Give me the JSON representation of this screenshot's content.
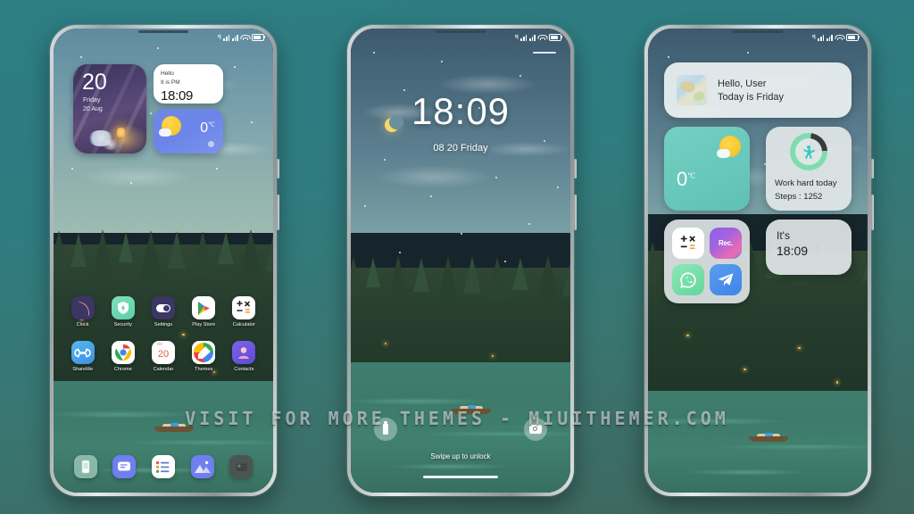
{
  "watermark": "VISIT FOR MORE THEMES - MIUITHEMER.COM",
  "colors": {
    "background_top": "#2d7d83",
    "background_bottom": "#3e655d",
    "accent_teal": "#68c8bb",
    "accent_blue": "#6f86e6",
    "ring_green": "#7fdcb0",
    "widget_grey": "#e2e7e8"
  },
  "status_bar": {
    "icons": [
      "nfc-icon",
      "signal-bars-icon",
      "signal-bars-icon",
      "wifi-icon",
      "battery-icon"
    ]
  },
  "phone1": {
    "label": "home-screen",
    "calendar_widget": {
      "day": "20",
      "weekday": "Friday",
      "date": "20 Aug"
    },
    "hello_widget": {
      "greeting": "Hello",
      "subtitle": "It is PM",
      "time": "18:09"
    },
    "weather_widget": {
      "temperature": "0",
      "unit": "℃",
      "icon": "sun-cloud-icon"
    },
    "apps_row1": [
      {
        "label": "Clock",
        "icon": "clock-icon"
      },
      {
        "label": "Security",
        "icon": "shield-icon"
      },
      {
        "label": "Settings",
        "icon": "toggle-icon"
      },
      {
        "label": "Play Store",
        "icon": "play-store-icon"
      },
      {
        "label": "Calculator",
        "icon": "calculator-icon"
      }
    ],
    "apps_row2": [
      {
        "label": "ShareMe",
        "icon": "shareme-icon"
      },
      {
        "label": "Chrome",
        "icon": "chrome-icon"
      },
      {
        "label": "Calendar",
        "icon": "calendar-icon"
      },
      {
        "label": "Themes",
        "icon": "themes-icon"
      },
      {
        "label": "Contacts",
        "icon": "contacts-icon"
      }
    ],
    "dock": [
      {
        "label": "Phone",
        "icon": "phone-icon"
      },
      {
        "label": "Messages",
        "icon": "messages-icon"
      },
      {
        "label": "Notes",
        "icon": "notes-icon"
      },
      {
        "label": "Gallery",
        "icon": "gallery-icon"
      },
      {
        "label": "Camera",
        "icon": "camera-icon"
      }
    ]
  },
  "phone2": {
    "label": "lock-screen",
    "time": "18:09",
    "date": "08 20 Friday",
    "hint": "Swipe up to unlock",
    "left_button": "flashlight-icon",
    "right_button": "camera-icon"
  },
  "phone3": {
    "label": "home-screen-widgets",
    "hello_widget": {
      "line1": "Hello, User",
      "line2": "Today is Friday",
      "thumb": "map-thumbnail"
    },
    "weather_widget": {
      "temperature": "0",
      "unit": "℃",
      "icon": "sun-cloud-icon"
    },
    "steps_widget": {
      "title": "Work hard today",
      "steps": "Steps : 1252",
      "icon": "runner-icon",
      "progress_percent": 78
    },
    "folder_widget": {
      "apps": [
        {
          "label": "Calculator",
          "icon": "calculator-icon"
        },
        {
          "label": "Rec.",
          "icon": "recorder-icon"
        },
        {
          "label": "WhatsApp",
          "icon": "whatsapp-icon"
        },
        {
          "label": "Telegram",
          "icon": "telegram-icon"
        }
      ]
    },
    "clock_widget": {
      "line1": "It's",
      "line2": "18:09"
    }
  }
}
